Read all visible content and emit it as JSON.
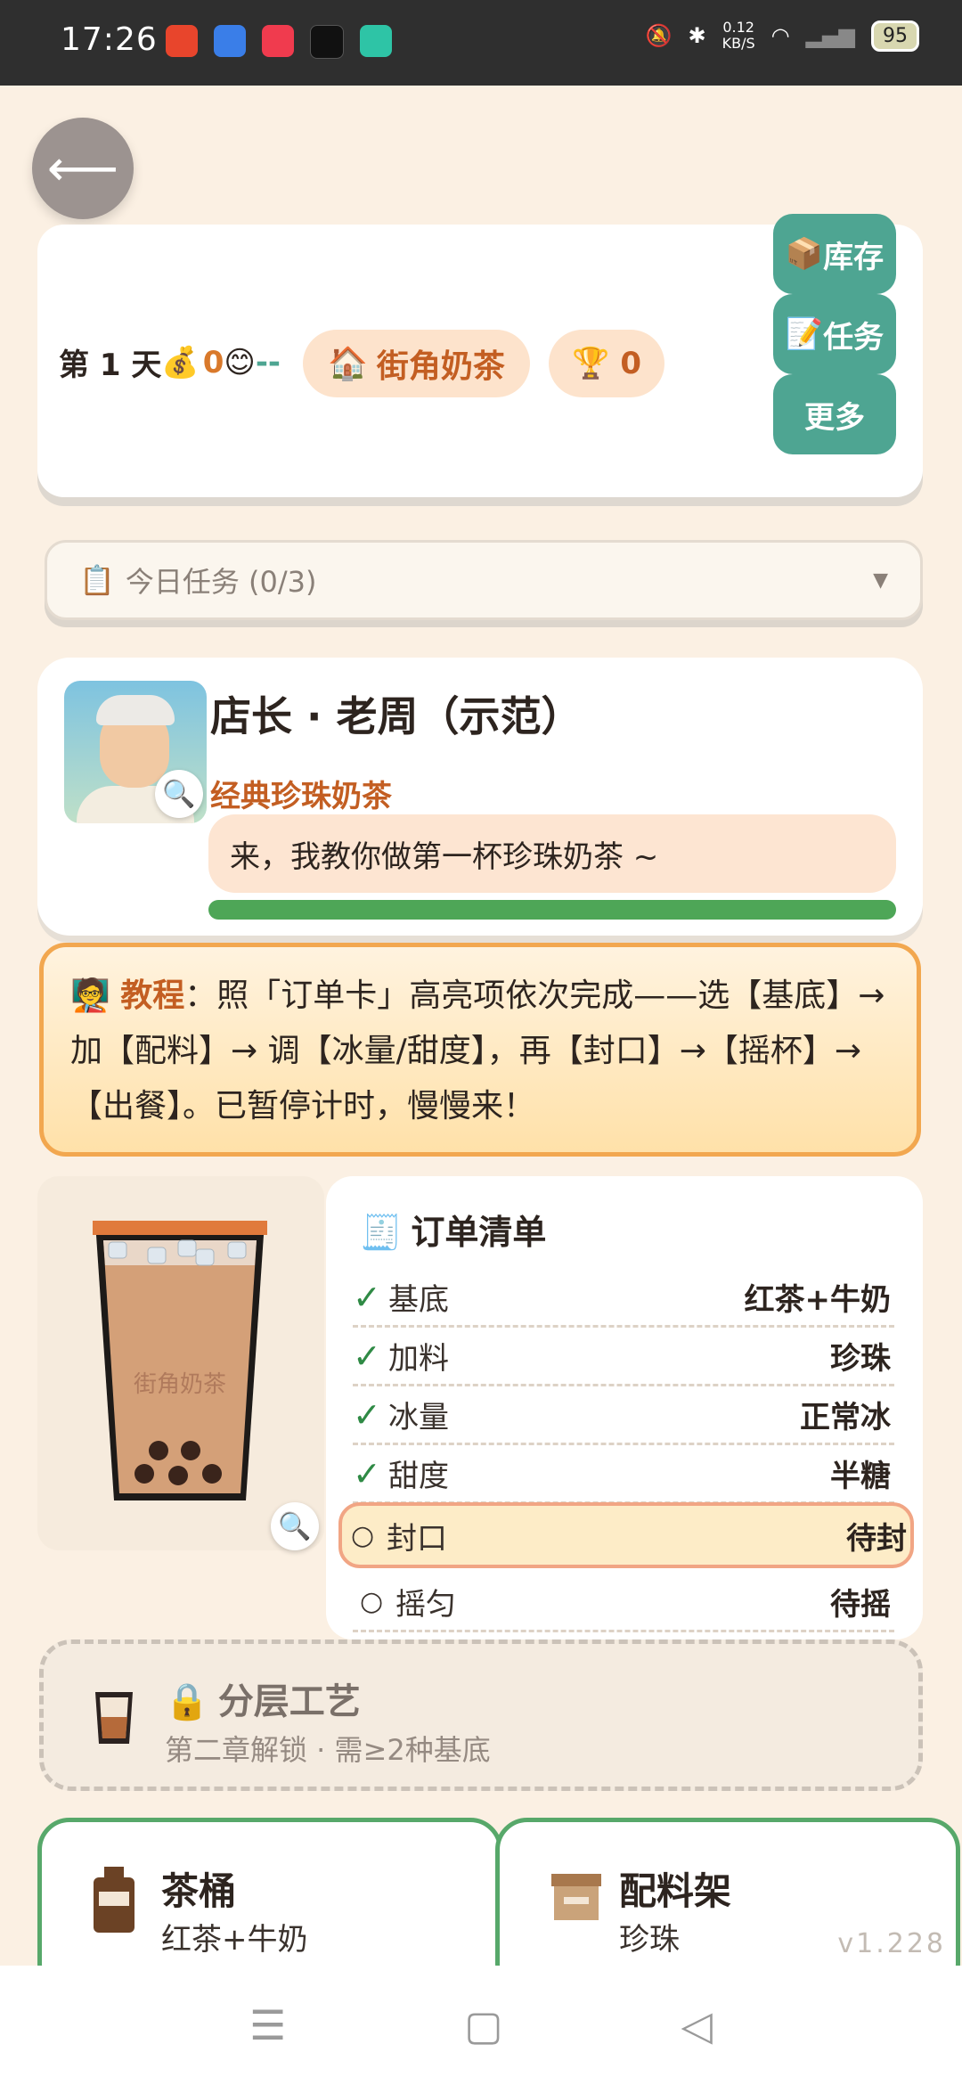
{
  "status_bar": {
    "time": "17:26",
    "net_speed_top": "0.12",
    "net_speed_bottom": "KB/S",
    "battery": "95"
  },
  "header": {
    "day_label": "第 1 天",
    "coins": "0",
    "mood_value": "--",
    "shop_name": "街角奶茶",
    "trophies": "0",
    "buttons": {
      "inventory": "库存",
      "tasks": "任务",
      "more": "更多"
    }
  },
  "task_dropdown": {
    "label": "今日任务 (0/3)"
  },
  "customer": {
    "name": "店长 · 老周（示范）",
    "order": "经典珍珠奶茶",
    "dialogue": "来，我教你做第一杯珍珠奶茶 ~",
    "patience": 1.0
  },
  "tutorial": {
    "tag": "教程",
    "text": "：照「订单卡」高亮项依次完成——选【基底】→ 加【配料】→ 调【冰量/甜度】，再【封口】→【摇杯】→【出餐】。已暂停计时，慢慢来！"
  },
  "cup": {
    "label": "街角奶茶"
  },
  "order_card": {
    "title": "订单清单",
    "rows": [
      {
        "name": "基底",
        "value": "红茶+牛奶",
        "done": true
      },
      {
        "name": "加料",
        "value": "珍珠",
        "done": true
      },
      {
        "name": "冰量",
        "value": "正常冰",
        "done": true
      },
      {
        "name": "甜度",
        "value": "半糖",
        "done": true
      },
      {
        "name": "封口",
        "value": "待封",
        "done": false
      },
      {
        "name": "摇匀",
        "value": "待摇",
        "done": false
      }
    ]
  },
  "locked_feature": {
    "title": "分层工艺",
    "subtitle": "第二章解锁 · 需≥2种基底"
  },
  "stations": {
    "tea_bucket": {
      "title": "茶桶",
      "subtitle": "红茶+牛奶"
    },
    "topping_rack": {
      "title": "配料架",
      "subtitle": "珍珠"
    }
  },
  "version": "v1.228",
  "colors": {
    "accent_green": "#4ea592",
    "accent_orange": "#c35e22",
    "background": "#fbf0e3"
  }
}
